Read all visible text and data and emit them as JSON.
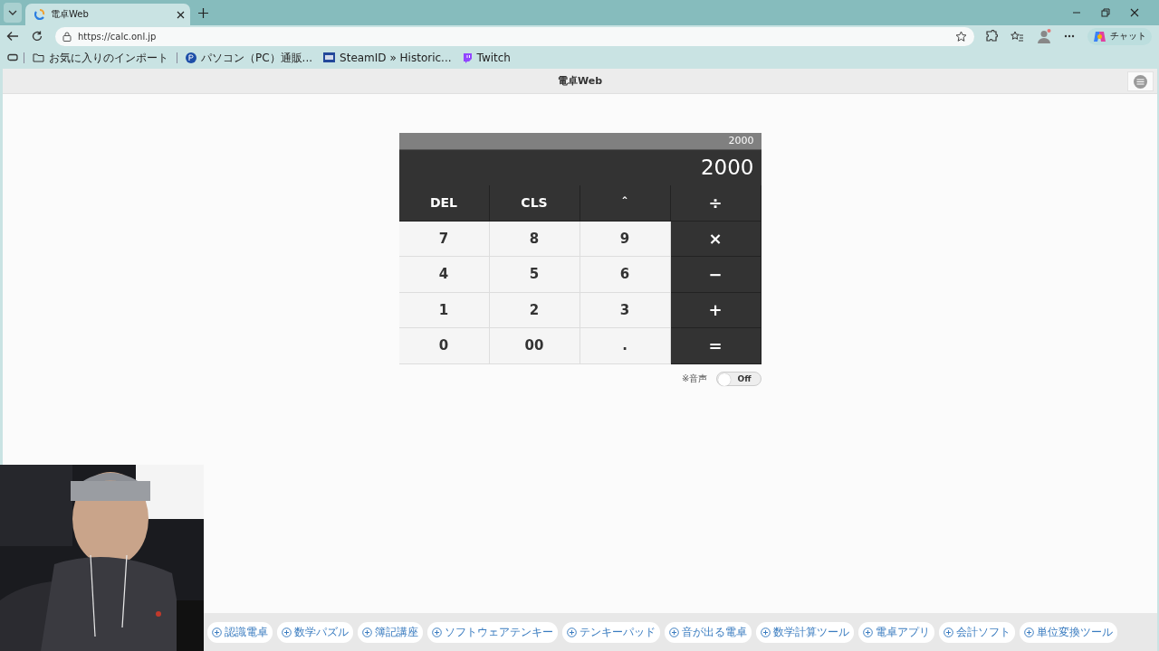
{
  "browser": {
    "tab": {
      "title": "電卓Web",
      "selected": true
    },
    "url": "https://calc.onl.jp",
    "copilot_label": "チャット",
    "bookmarks": [
      {
        "label": "お気に入りのインポート",
        "kind": "folder"
      },
      {
        "label": "パソコン（PC）通販...",
        "kind": "p"
      },
      {
        "label": "SteamID » Historic...",
        "kind": "sid"
      },
      {
        "label": "Twitch",
        "kind": "twitch"
      }
    ]
  },
  "page": {
    "title": "電卓Web",
    "display": {
      "history": "2000",
      "value": "2000"
    },
    "keys": [
      {
        "label": "DEL",
        "kind": "function"
      },
      {
        "label": "CLS",
        "kind": "function"
      },
      {
        "label": "ˆ",
        "kind": "function"
      },
      {
        "label": "÷",
        "kind": "operator"
      },
      {
        "label": "7",
        "kind": "digit"
      },
      {
        "label": "8",
        "kind": "digit"
      },
      {
        "label": "9",
        "kind": "digit"
      },
      {
        "label": "×",
        "kind": "operator"
      },
      {
        "label": "4",
        "kind": "digit"
      },
      {
        "label": "5",
        "kind": "digit"
      },
      {
        "label": "6",
        "kind": "digit"
      },
      {
        "label": "−",
        "kind": "operator"
      },
      {
        "label": "1",
        "kind": "digit"
      },
      {
        "label": "2",
        "kind": "digit"
      },
      {
        "label": "3",
        "kind": "digit"
      },
      {
        "label": "+",
        "kind": "operator"
      },
      {
        "label": "0",
        "kind": "digit"
      },
      {
        "label": "00",
        "kind": "digit"
      },
      {
        "label": ".",
        "kind": "digit"
      },
      {
        "label": "=",
        "kind": "operator"
      }
    ],
    "sound": {
      "label": "※音声",
      "on": false,
      "state_label": "Off"
    },
    "links": [
      "認識電卓",
      "数学パズル",
      "簿記講座",
      "ソフトウェアテンキー",
      "テンキーパッド",
      "音が出る電卓",
      "数学計算ツール",
      "電卓アプリ",
      "会計ソフト",
      "単位変換ツール"
    ]
  }
}
